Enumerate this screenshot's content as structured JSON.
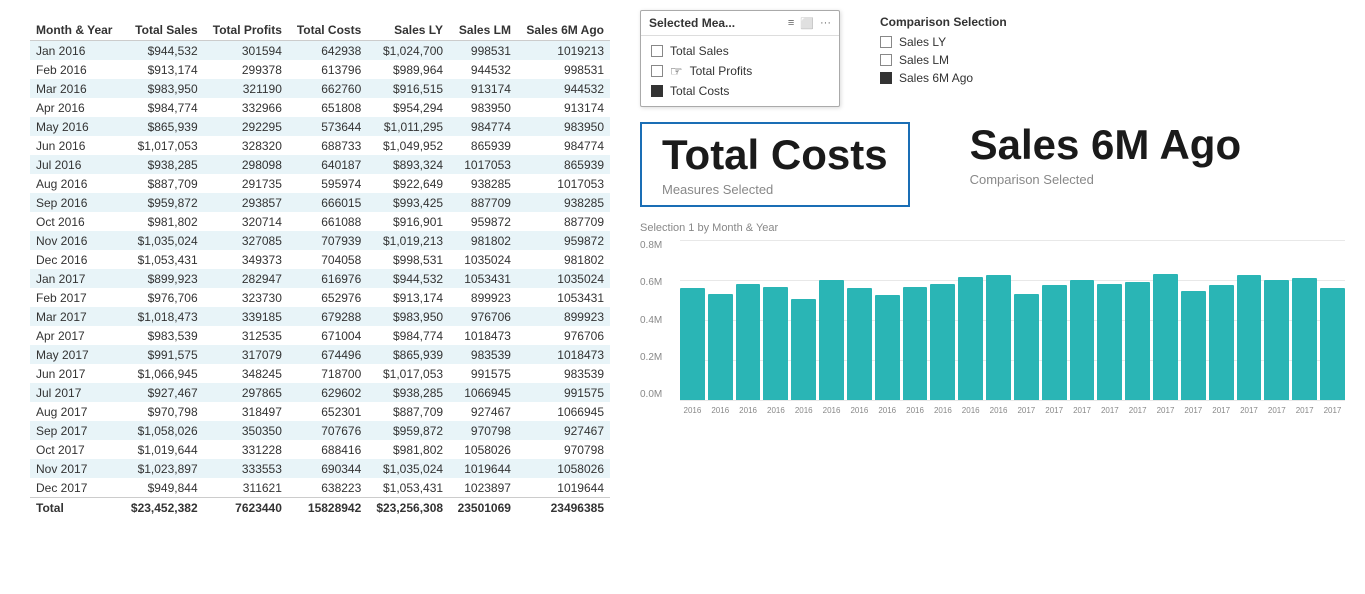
{
  "table": {
    "headers": [
      "Month & Year",
      "Total Sales",
      "Total Profits",
      "Total Costs",
      "Sales LY",
      "Sales LM",
      "Sales 6M Ago"
    ],
    "rows": [
      [
        "Jan 2016",
        "$944,532",
        "301594",
        "642938",
        "$1,024,700",
        "998531",
        "1019213"
      ],
      [
        "Feb 2016",
        "$913,174",
        "299378",
        "613796",
        "$989,964",
        "944532",
        "998531"
      ],
      [
        "Mar 2016",
        "$983,950",
        "321190",
        "662760",
        "$916,515",
        "913174",
        "944532"
      ],
      [
        "Apr 2016",
        "$984,774",
        "332966",
        "651808",
        "$954,294",
        "983950",
        "913174"
      ],
      [
        "May 2016",
        "$865,939",
        "292295",
        "573644",
        "$1,011,295",
        "984774",
        "983950"
      ],
      [
        "Jun 2016",
        "$1,017,053",
        "328320",
        "688733",
        "$1,049,952",
        "865939",
        "984774"
      ],
      [
        "Jul 2016",
        "$938,285",
        "298098",
        "640187",
        "$893,324",
        "1017053",
        "865939"
      ],
      [
        "Aug 2016",
        "$887,709",
        "291735",
        "595974",
        "$922,649",
        "938285",
        "1017053"
      ],
      [
        "Sep 2016",
        "$959,872",
        "293857",
        "666015",
        "$993,425",
        "887709",
        "938285"
      ],
      [
        "Oct 2016",
        "$981,802",
        "320714",
        "661088",
        "$916,901",
        "959872",
        "887709"
      ],
      [
        "Nov 2016",
        "$1,035,024",
        "327085",
        "707939",
        "$1,019,213",
        "981802",
        "959872"
      ],
      [
        "Dec 2016",
        "$1,053,431",
        "349373",
        "704058",
        "$998,531",
        "1035024",
        "981802"
      ],
      [
        "Jan 2017",
        "$899,923",
        "282947",
        "616976",
        "$944,532",
        "1053431",
        "1035024"
      ],
      [
        "Feb 2017",
        "$976,706",
        "323730",
        "652976",
        "$913,174",
        "899923",
        "1053431"
      ],
      [
        "Mar 2017",
        "$1,018,473",
        "339185",
        "679288",
        "$983,950",
        "976706",
        "899923"
      ],
      [
        "Apr 2017",
        "$983,539",
        "312535",
        "671004",
        "$984,774",
        "1018473",
        "976706"
      ],
      [
        "May 2017",
        "$991,575",
        "317079",
        "674496",
        "$865,939",
        "983539",
        "1018473"
      ],
      [
        "Jun 2017",
        "$1,066,945",
        "348245",
        "718700",
        "$1,017,053",
        "991575",
        "983539"
      ],
      [
        "Jul 2017",
        "$927,467",
        "297865",
        "629602",
        "$938,285",
        "1066945",
        "991575"
      ],
      [
        "Aug 2017",
        "$970,798",
        "318497",
        "652301",
        "$887,709",
        "927467",
        "1066945"
      ],
      [
        "Sep 2017",
        "$1,058,026",
        "350350",
        "707676",
        "$959,872",
        "970798",
        "927467"
      ],
      [
        "Oct 2017",
        "$1,019,644",
        "331228",
        "688416",
        "$981,802",
        "1058026",
        "970798"
      ],
      [
        "Nov 2017",
        "$1,023,897",
        "333553",
        "690344",
        "$1,035,024",
        "1019644",
        "1058026"
      ],
      [
        "Dec 2017",
        "$949,844",
        "311621",
        "638223",
        "$1,053,431",
        "1023897",
        "1019644"
      ]
    ],
    "footer": [
      "Total",
      "$23,452,382",
      "7623440",
      "15828942",
      "$23,256,308",
      "23501069",
      "23496385"
    ]
  },
  "dropdown": {
    "title": "Selected Mea...",
    "items": [
      {
        "label": "Total Sales",
        "checked": false
      },
      {
        "label": "Total Profits",
        "checked": false
      },
      {
        "label": "Total Costs",
        "checked": true
      }
    ]
  },
  "comparison_selection": {
    "title": "Comparison Selection",
    "items": [
      {
        "label": "Sales LY",
        "checked": false
      },
      {
        "label": "Sales LM",
        "checked": false
      },
      {
        "label": "Sales 6M Ago",
        "checked": true
      }
    ]
  },
  "metric_main": {
    "value": "Total Costs",
    "label": "Measures Selected"
  },
  "metric_secondary": {
    "value": "Sales 6M Ago",
    "label": "Comparison Selected"
  },
  "chart": {
    "title": "Selection 1 by Month & Year",
    "y_labels": [
      "0.8M",
      "0.6M",
      "0.4M",
      "0.2M",
      "0.0M"
    ],
    "bars": [
      {
        "height": 80,
        "label": "2016"
      },
      {
        "height": 76,
        "label": "2016"
      },
      {
        "height": 83,
        "label": "2016"
      },
      {
        "height": 81,
        "label": "2016"
      },
      {
        "height": 72,
        "label": "2016"
      },
      {
        "height": 86,
        "label": "2016"
      },
      {
        "height": 80,
        "label": "2016"
      },
      {
        "height": 75,
        "label": "2016"
      },
      {
        "height": 81,
        "label": "2016"
      },
      {
        "height": 83,
        "label": "2016"
      },
      {
        "height": 88,
        "label": "2016"
      },
      {
        "height": 89,
        "label": "2016"
      },
      {
        "height": 76,
        "label": "2017"
      },
      {
        "height": 82,
        "label": "2017"
      },
      {
        "height": 86,
        "label": "2017"
      },
      {
        "height": 83,
        "label": "2017"
      },
      {
        "height": 84,
        "label": "2017"
      },
      {
        "height": 90,
        "label": "2017"
      },
      {
        "height": 78,
        "label": "2017"
      },
      {
        "height": 82,
        "label": "2017"
      },
      {
        "height": 89,
        "label": "2017"
      },
      {
        "height": 86,
        "label": "2017"
      },
      {
        "height": 87,
        "label": "2017"
      },
      {
        "height": 80,
        "label": "2017"
      }
    ]
  }
}
